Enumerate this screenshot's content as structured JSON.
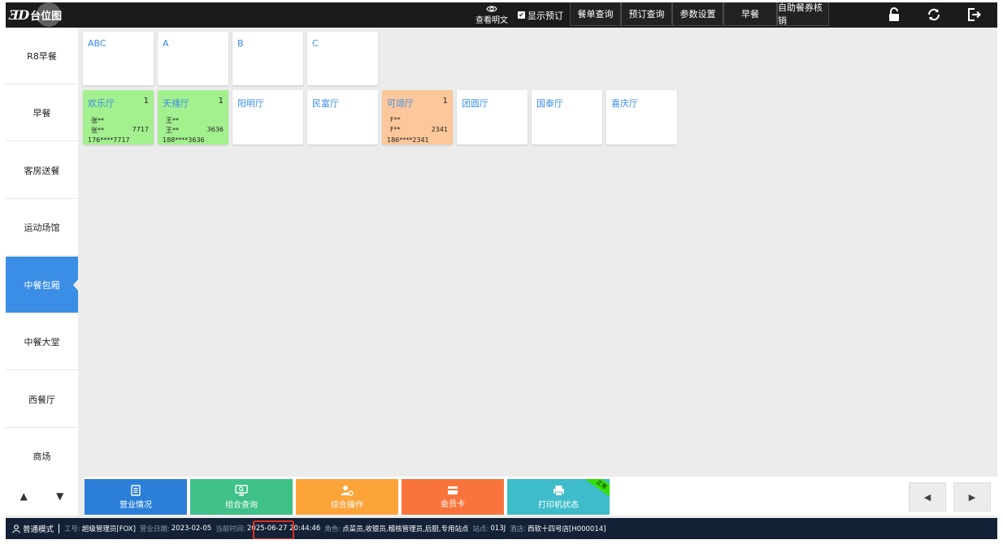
{
  "topbar": {
    "logo_mark": "ƎD",
    "title": "台位图",
    "view_clear": "查看明文",
    "show_reserve": "显示预订",
    "nav": [
      "餐单查询",
      "预订查询",
      "参数设置",
      "早餐",
      "自助餐券核销"
    ]
  },
  "sidebar": {
    "items": [
      "R8早餐",
      "早餐",
      "客房送餐",
      "运动场馆",
      "中餐包厢",
      "中餐大堂",
      "西餐厅",
      "商场"
    ],
    "active_index": 4
  },
  "tables_row1": [
    {
      "name": "ABC"
    },
    {
      "name": "A"
    },
    {
      "name": "B"
    },
    {
      "name": "C"
    }
  ],
  "tables_row2": [
    {
      "name": "欢乐厅",
      "count": "1",
      "guest1": "张**",
      "guest2": "张**",
      "tail": "7717",
      "phone": "176****7717",
      "status": "green"
    },
    {
      "name": "天禧厅",
      "count": "1",
      "guest1": "王**",
      "guest2": "王**",
      "tail": "3636",
      "phone": "188****3636",
      "status": "green"
    },
    {
      "name": "阳明厅"
    },
    {
      "name": "民富厅"
    },
    {
      "name": "可颂厅",
      "count": "1",
      "guest1": "F**",
      "guest2": "F**",
      "tail": "2341",
      "phone": "186****2341",
      "status": "orange"
    },
    {
      "name": "团圆厅"
    },
    {
      "name": "国泰厅"
    },
    {
      "name": "喜庆厅"
    }
  ],
  "actions": [
    {
      "label": "营业情况",
      "color": "#2b7fd8"
    },
    {
      "label": "组合查询",
      "color": "#3fc188"
    },
    {
      "label": "综合操作",
      "color": "#fca33a"
    },
    {
      "label": "会员卡",
      "color": "#f9743c"
    },
    {
      "label": "打印机状态",
      "color": "#3fbcc9",
      "badge": "正常"
    }
  ],
  "status": {
    "mode": "普通模式",
    "staff_label": "工号:",
    "staff": "超级管理员[FOX]",
    "bizdate_label": "营业日期:",
    "bizdate": "2023-02-05",
    "time_label": "当前时间:",
    "time": "2025-06-27 20:44:46",
    "role_label": "角色:",
    "role": "点菜员,收银员,稽核管理员,后厨,专用站点",
    "station_label": "站点:",
    "station": "013J",
    "store_label": "酒店:",
    "store": "西软十四号店[H000014]"
  },
  "colors": {
    "topbar_bg": "#1b1b1b",
    "active_side": "#3a8ee6",
    "table_name": "#3a8ee6",
    "occupied_green": "#a3f08f",
    "reserved_orange": "#fcc79a",
    "statusbar_bg": "#132236",
    "highlight_red": "#e02b20"
  }
}
